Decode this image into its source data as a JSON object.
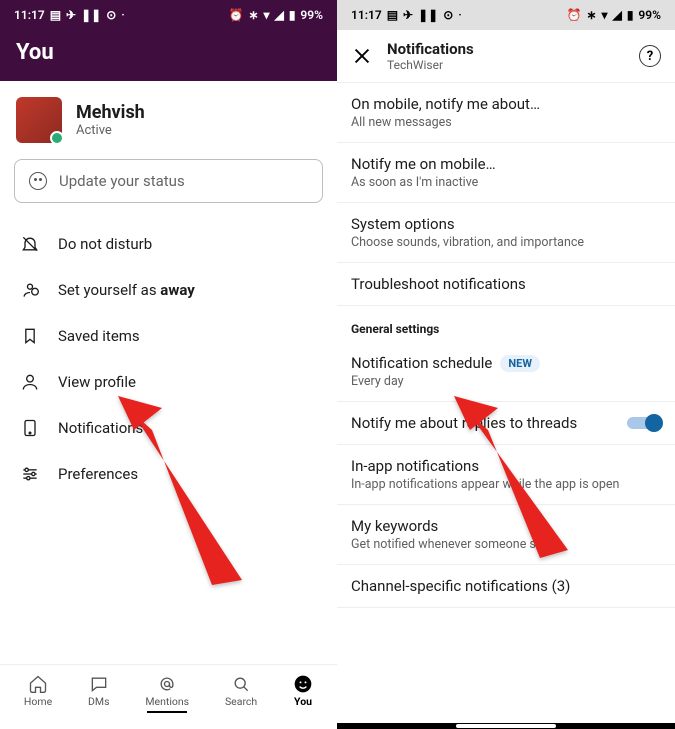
{
  "status_bar": {
    "time": "11:17",
    "battery": "99%"
  },
  "left": {
    "header_title": "You",
    "profile": {
      "name": "Mehvish",
      "status": "Active"
    },
    "status_placeholder": "Update your status",
    "menu": {
      "dnd": "Do not disturb",
      "away_prefix": "Set yourself as ",
      "away_bold": "away",
      "saved": "Saved items",
      "view_profile": "View profile",
      "notifications": "Notifications",
      "preferences": "Preferences"
    },
    "tabs": {
      "home": "Home",
      "dms": "DMs",
      "mentions": "Mentions",
      "search": "Search",
      "you": "You"
    }
  },
  "right": {
    "header_title": "Notifications",
    "header_sub": "TechWiser",
    "items": {
      "mobile_notify_title": "On mobile, notify me about…",
      "mobile_notify_sub": "All new messages",
      "notify_mobile_title": "Notify me on mobile…",
      "notify_mobile_sub": "As soon as I'm inactive",
      "system_title": "System options",
      "system_sub": "Choose sounds, vibration, and importance",
      "troubleshoot": "Troubleshoot notifications",
      "section": "General settings",
      "schedule_title": "Notification schedule",
      "schedule_sub": "Every day",
      "new_badge": "NEW",
      "threads": "Notify me about replies to threads",
      "inapp_title": "In-app notifications",
      "inapp_sub": "In-app notifications appear while the app is open",
      "keywords_title": "My keywords",
      "keywords_sub": "Get notified whenever someone says…",
      "channel_specific": "Channel-specific notifications (3)"
    }
  }
}
